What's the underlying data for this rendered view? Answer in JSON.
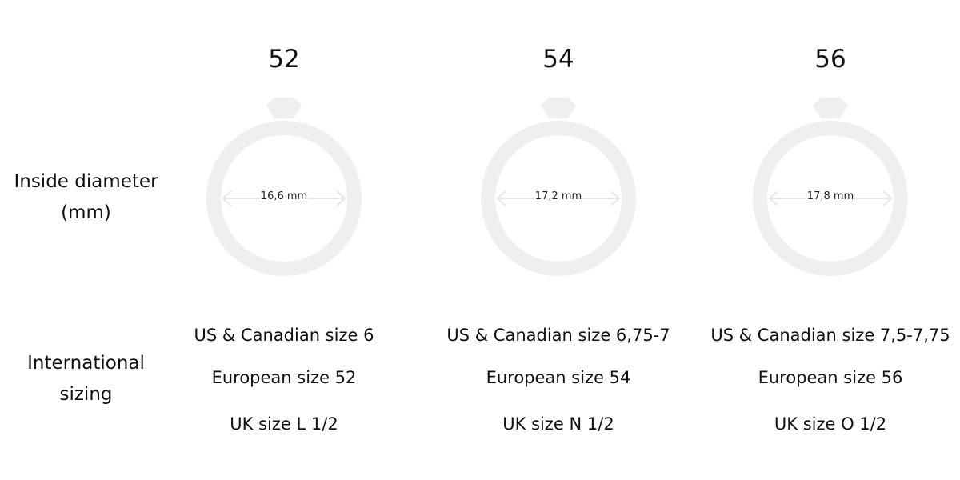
{
  "row_labels": {
    "diameter": {
      "line1": "Inside diameter",
      "line2": "(mm)"
    },
    "sizing": {
      "line1": "International",
      "line2": "sizing"
    }
  },
  "colors": {
    "ring": "#efefef",
    "arrow": "#e6e6e6",
    "text": "#111111"
  },
  "columns": [
    {
      "size": "52",
      "diameter": "16,6 mm",
      "us": "US & Canadian size 6",
      "eu": "European size 52",
      "uk": "UK size L 1/2"
    },
    {
      "size": "54",
      "diameter": "17,2 mm",
      "us": "US & Canadian size 6,75-7",
      "eu": "European size 54",
      "uk": "UK size N 1/2"
    },
    {
      "size": "56",
      "diameter": "17,8 mm",
      "us": "US & Canadian size 7,5-7,75",
      "eu": "European size 56",
      "uk": "UK size O 1/2"
    }
  ]
}
